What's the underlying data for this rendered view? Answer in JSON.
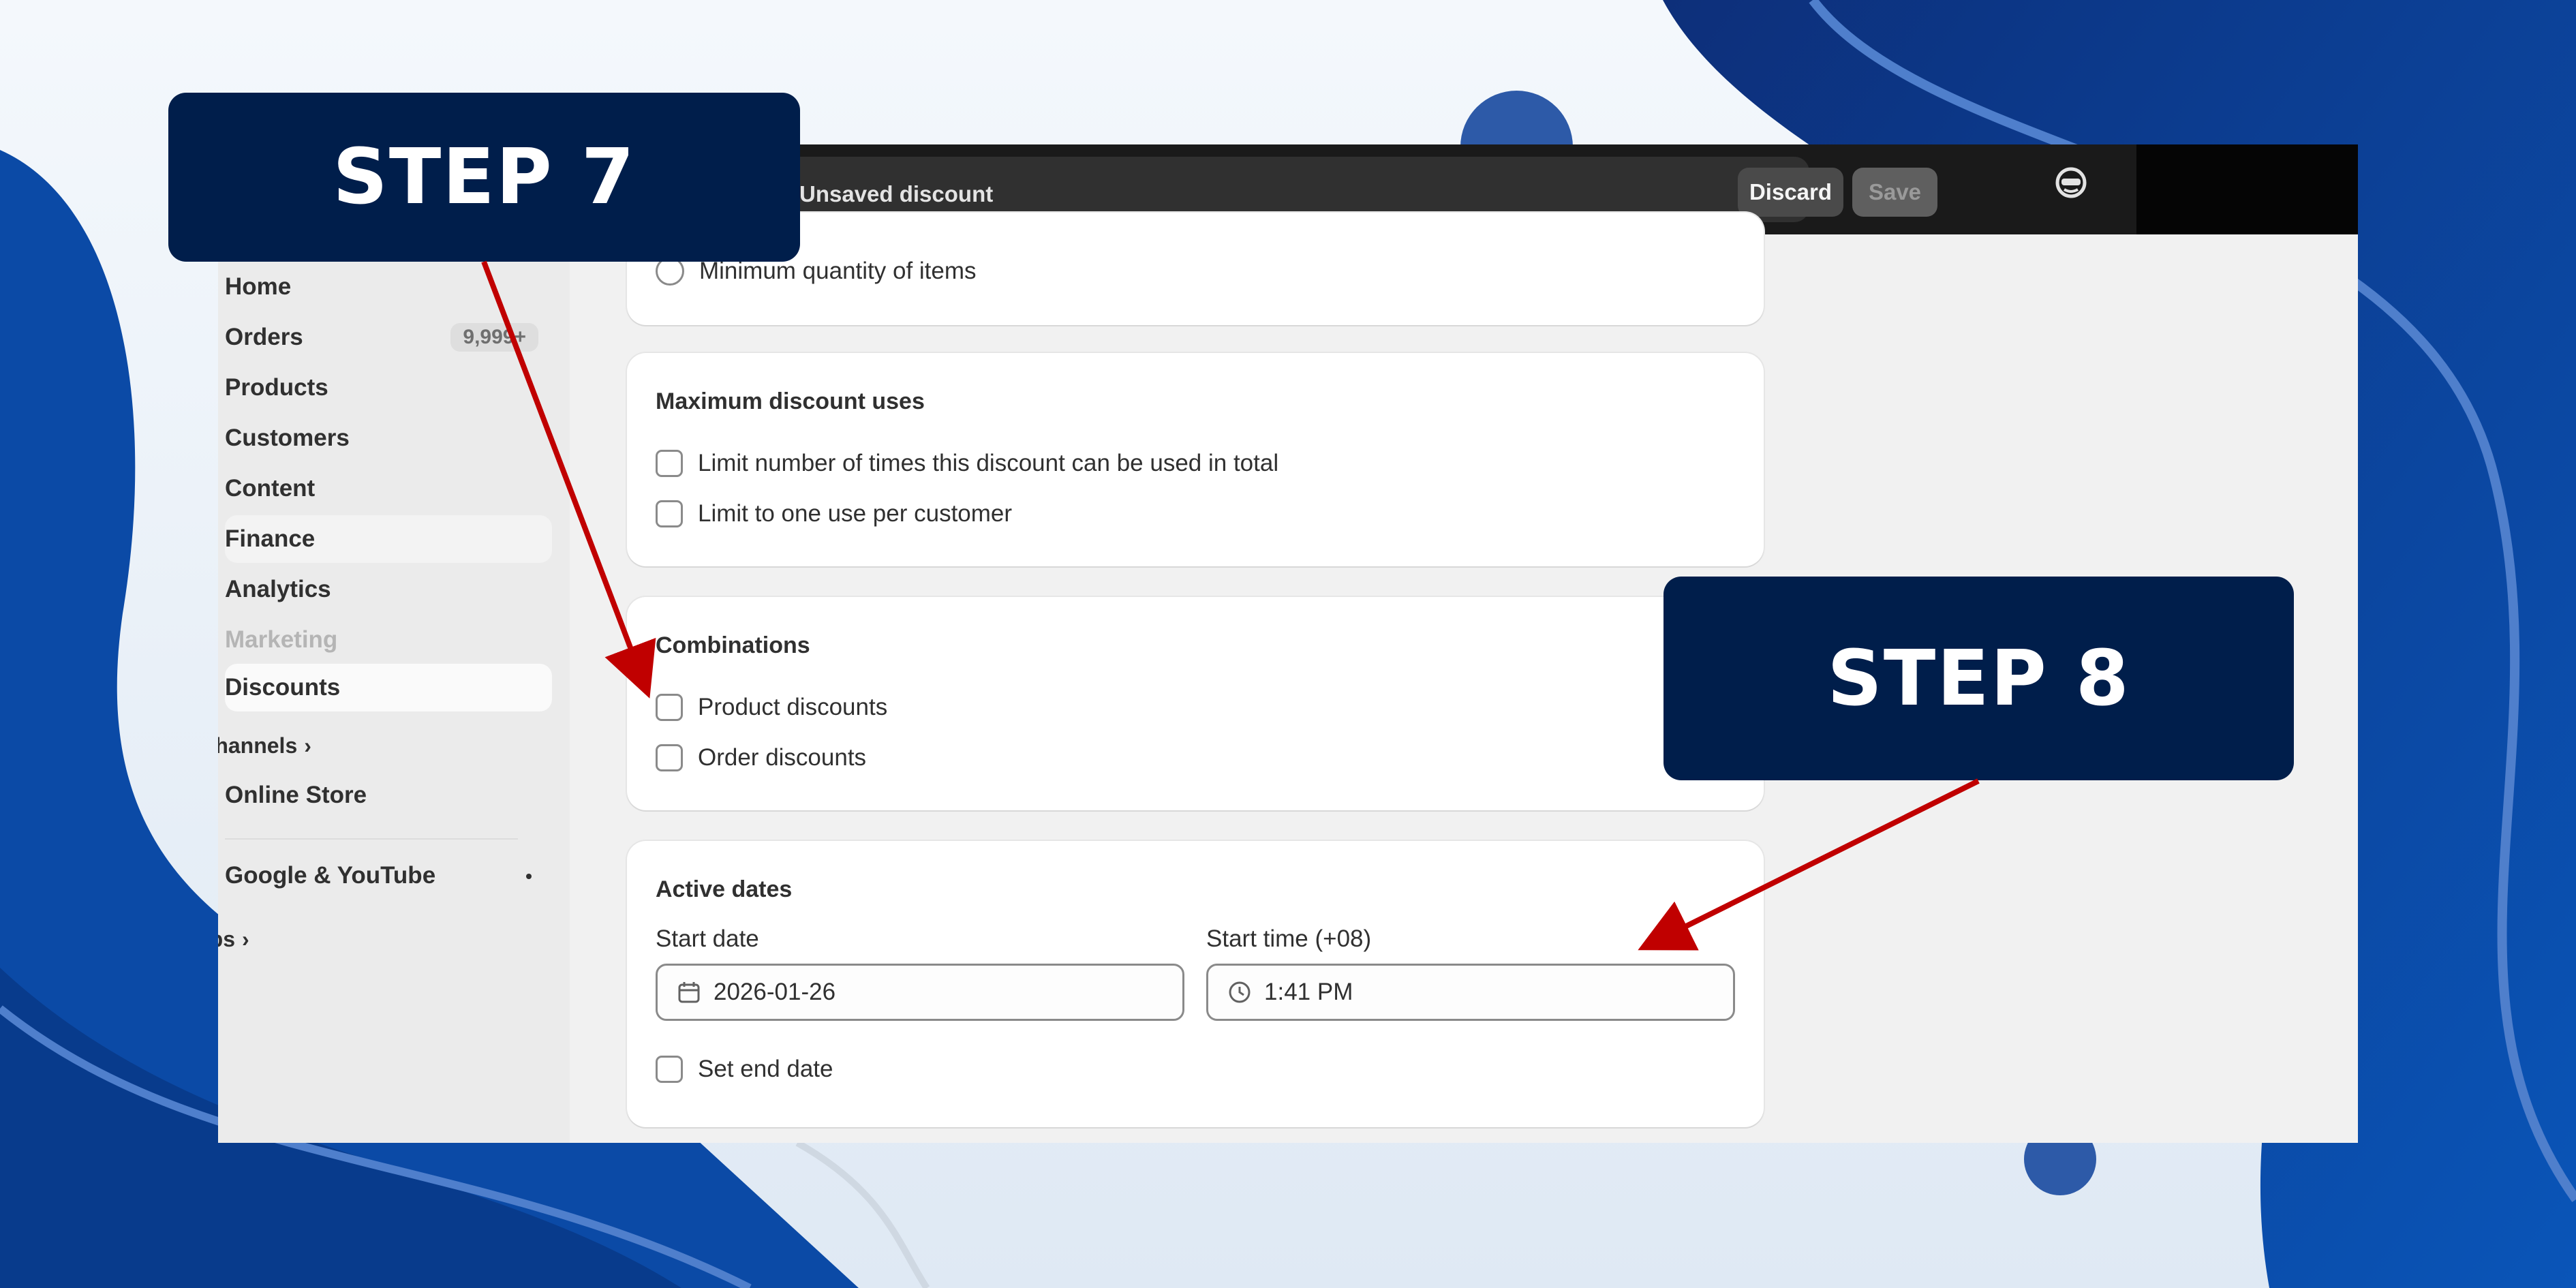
{
  "topbar": {
    "title": "Unsaved discount",
    "discard_label": "Discard",
    "save_label": "Save"
  },
  "sidebar": {
    "items": [
      {
        "label": "Home"
      },
      {
        "label": "Orders",
        "badge": "9,999+"
      },
      {
        "label": "Products"
      },
      {
        "label": "Customers"
      },
      {
        "label": "Content"
      },
      {
        "label": "Finance"
      },
      {
        "label": "Analytics"
      },
      {
        "label": "Marketing"
      },
      {
        "label": "Discounts"
      }
    ],
    "sales_channels_label": "Sales channels",
    "online_store_label": "Online Store",
    "google_label": "Google & YouTube",
    "apps_label": "Apps"
  },
  "min_requirements": {
    "option_label": "Minimum quantity of items"
  },
  "max_uses": {
    "title": "Maximum discount uses",
    "options": [
      "Limit number of times this discount can be used in total",
      "Limit to one use per customer"
    ]
  },
  "combinations": {
    "title": "Combinations",
    "options": [
      "Product discounts",
      "Order discounts"
    ]
  },
  "active_dates": {
    "title": "Active dates",
    "start_date_label": "Start date",
    "start_date_value": "2026-01-26",
    "start_time_label": "Start time (+08)",
    "start_time_value": "1:41 PM",
    "end_date_label": "Set end date"
  },
  "overlays": {
    "step7": "STEP 7",
    "step8": "STEP 8"
  },
  "colors": {
    "step_box": "#001e4b",
    "arrow": "#c00000",
    "background": "#0a3f96"
  }
}
